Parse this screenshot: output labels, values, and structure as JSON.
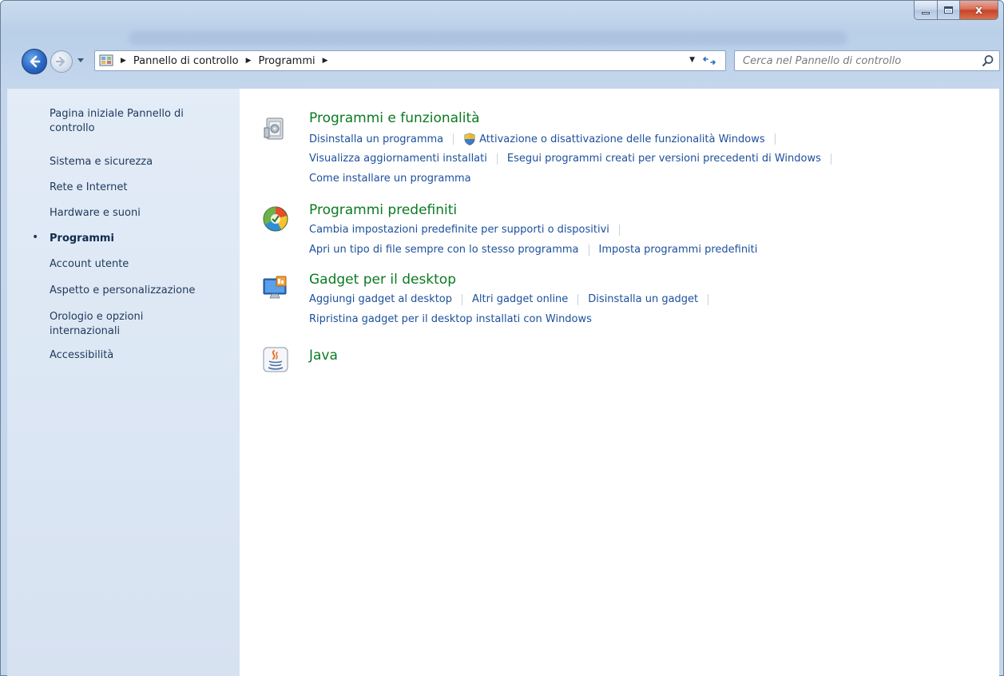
{
  "window": {
    "caption": {
      "minimize_icon": "minimize-icon",
      "maximize_icon": "maximize-icon",
      "close_icon": "close-icon",
      "close_glyph": "x"
    }
  },
  "navbar": {
    "breadcrumbs": [
      "Pannello di controllo",
      "Programmi"
    ],
    "search_placeholder": "Cerca nel Pannello di controllo"
  },
  "sidebar": {
    "items": [
      {
        "label": "Pagina iniziale Pannello di controllo",
        "active": false
      },
      {
        "label": "Sistema e sicurezza",
        "active": false
      },
      {
        "label": "Rete e Internet",
        "active": false
      },
      {
        "label": "Hardware e suoni",
        "active": false
      },
      {
        "label": "Programmi",
        "active": true
      },
      {
        "label": "Account utente",
        "active": false
      },
      {
        "label": "Aspetto e personalizzazione",
        "active": false
      },
      {
        "label": "Orologio e opzioni internazionali",
        "active": false
      },
      {
        "label": "Accessibilità",
        "active": false
      }
    ]
  },
  "main": {
    "categories": [
      {
        "title": "Programmi e funzionalità",
        "icon": "programs-features-icon",
        "rows": [
          [
            "Disinstalla un programma",
            "Attivazione o disattivazione delle funzionalità Windows"
          ],
          [
            "Visualizza aggiornamenti installati",
            "Esegui programmi creati per versioni precedenti di Windows"
          ],
          [
            "Come installare un programma"
          ]
        ]
      },
      {
        "title": "Programmi predefiniti",
        "icon": "default-programs-icon",
        "rows": [
          [
            "Cambia impostazioni predefinite per supporti o dispositivi"
          ],
          [
            "Apri un tipo di file sempre con lo stesso programma",
            "Imposta programmi predefiniti"
          ]
        ]
      },
      {
        "title": "Gadget per il desktop",
        "icon": "desktop-gadgets-icon",
        "rows": [
          [
            "Aggiungi gadget al desktop",
            "Altri gadget online",
            "Disinstalla un gadget"
          ],
          [
            "Ripristina gadget per il desktop installati con Windows"
          ]
        ]
      },
      {
        "title": "Java",
        "icon": "java-icon",
        "rows": []
      }
    ]
  },
  "colors": {
    "category_title": "#0b7a22",
    "link": "#1c4f9c",
    "sidebar_text": "#1e395b",
    "sidebar_bg": "#dde7f4"
  }
}
